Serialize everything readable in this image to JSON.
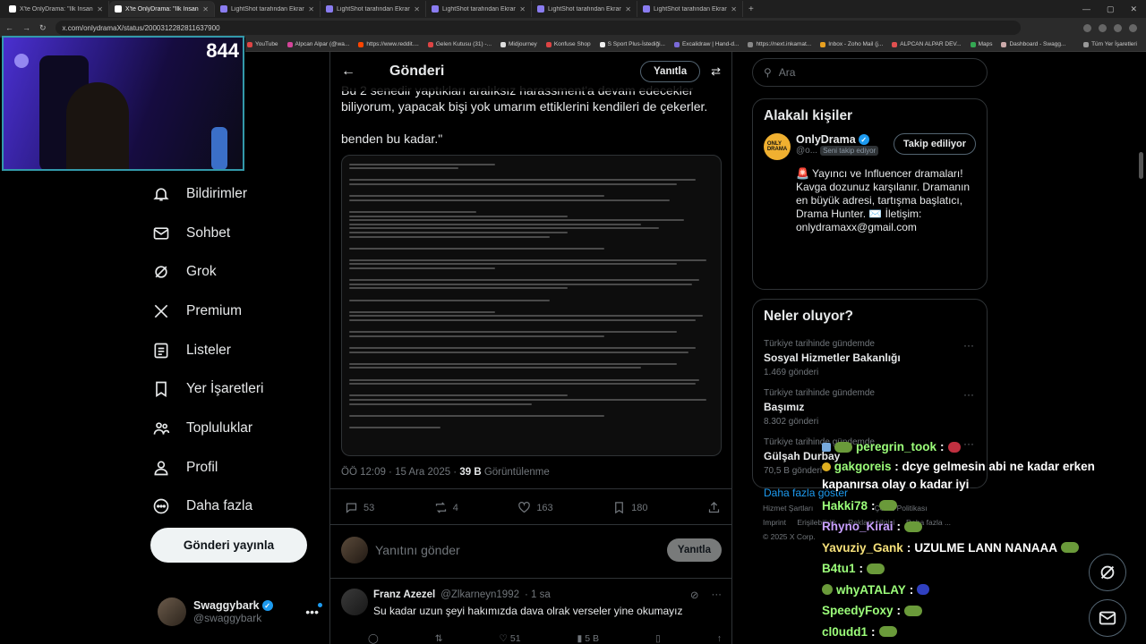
{
  "browser": {
    "tabs": [
      {
        "label": "X'te OnlyDrama: \"İlk İnsan-Jahe",
        "icon": "x",
        "active": false
      },
      {
        "label": "X'te OnlyDrama: \"İlk İnsan-Jahe",
        "icon": "x",
        "active": true
      },
      {
        "label": "LightShot tarafından Ekran Görü",
        "icon": "lightshot",
        "active": false
      },
      {
        "label": "LightShot tarafından Ekran Görü",
        "icon": "lightshot",
        "active": false
      },
      {
        "label": "LightShot tarafından Ekran Görü",
        "icon": "lightshot",
        "active": false
      },
      {
        "label": "LightShot tarafından Ekran Görü",
        "icon": "lightshot",
        "active": false
      },
      {
        "label": "LightShot tarafından Ekran Görü",
        "icon": "lightshot",
        "active": false
      }
    ],
    "url": "x.com/onlydramaX/status/2000312282811637900",
    "bookmarks": [
      "YouTube",
      "Alpcan Alpar (@wa...",
      "https://www.reddit....",
      "Gelen Kutusu (31) -...",
      "Midjourney",
      "Konfuse Shop",
      "S Sport Plus-İstediği...",
      "Excalidraw | Hand-d...",
      "https://next.inkamat...",
      "Inbox - Zoho Mail (j...",
      "ALPCAN ALPAR DEV...",
      "Maps",
      "Dashboard - Swagg..."
    ],
    "bookmarks_all": "Tüm Yer İşaretleri"
  },
  "stream": {
    "viewer_count": "844"
  },
  "nav": {
    "items": [
      {
        "label": "Bildirimler",
        "icon": "bell-icon"
      },
      {
        "label": "Sohbet",
        "icon": "mail-icon"
      },
      {
        "label": "Grok",
        "icon": "grok-icon"
      },
      {
        "label": "Premium",
        "icon": "x-logo-icon"
      },
      {
        "label": "Listeler",
        "icon": "list-icon"
      },
      {
        "label": "Yer İşaretleri",
        "icon": "bookmark-icon"
      },
      {
        "label": "Topluluklar",
        "icon": "people-icon"
      },
      {
        "label": "Profil",
        "icon": "person-icon"
      },
      {
        "label": "Daha fazla",
        "icon": "more-circle-icon"
      }
    ],
    "post_button": "Gönderi yayınla"
  },
  "account": {
    "name": "Swaggybark",
    "handle": "@swaggybark"
  },
  "header": {
    "title": "Gönderi",
    "reply_label": "Yanıtla"
  },
  "post": {
    "text_partial": "Bu 2 senedir yaptıkları aralıksız harassment'a devam edecekler biliyorum, yapacak bişi yok umarım ettiklerini kendileri de çekerler.",
    "text_end": "benden bu kadar.\"",
    "time": "ÖÖ 12:09 · 15 Ara 2025 ·",
    "views_count": "39 B",
    "views_label": "Görüntülenme",
    "stats": {
      "replies": "53",
      "reposts": "4",
      "likes": "163",
      "bookmarks": "180"
    }
  },
  "compose": {
    "placeholder": "Yanıtını gönder",
    "button": "Yanıtla"
  },
  "reply": {
    "name": "Franz Azezel",
    "handle": "@Zlkarneyn1992",
    "time": "· 1 sa",
    "text": "Su kadar uzun şeyi hakımızda dava olrak verseler yine okumayız",
    "stats": {
      "likes": "51",
      "views": "5 B"
    }
  },
  "right": {
    "search_placeholder": "Ara",
    "related_title": "Alakalı kişiler",
    "person": {
      "name": "OnlyDrama",
      "handle": "@o...",
      "follows_you": "Seni takip ediyor",
      "follow_button": "Takip ediliyor",
      "bio": "🚨 Yayıncı ve Influencer dramaları! Kavga dozunuz karşılanır. Dramanın en büyük adresi, tartışma başlatıcı, Drama Hunter. ✉️ İletişim: onlydramaxx@gmail.com"
    },
    "trends_title": "Neler oluyor?",
    "trends": [
      {
        "meta": "Türkiye tarihinde gündemde",
        "name": "Sosyal Hizmetler Bakanlığı",
        "count": "1.469 gönderi"
      },
      {
        "meta": "Türkiye tarihinde gündemde",
        "name": "Başımız",
        "count": "8.302 gönderi"
      },
      {
        "meta": "Türkiye tarihinde gündemde",
        "name": "Gülşah Durbay",
        "count": "70,5 B gönderi"
      }
    ],
    "show_more": "Daha fazla göster",
    "footer": [
      "Hizmet Şartları",
      "Çerez Politikası",
      "Imprint",
      "Erişilebilirlik",
      "Reklam bilgisi",
      "Daha fazla ...",
      "© 2025 X Corp."
    ]
  },
  "chat": [
    {
      "user": "peregrin_took",
      "msg": "",
      "color": "green"
    },
    {
      "user": "gakgoreis",
      "msg": "dcye gelmesin abi ne kadar erken kapanırsa olay o kadar iyi",
      "color": "green"
    },
    {
      "user": "Hakki78",
      "msg": "",
      "color": "green"
    },
    {
      "user": "Rhyno_Kirai",
      "msg": "",
      "color": "purple"
    },
    {
      "user": "Yavuziy_Gank",
      "msg": "UZULME LANN NANAAA",
      "color": "yellow"
    },
    {
      "user": "B4tu1",
      "msg": "",
      "color": "green"
    },
    {
      "user": "whyATALAY",
      "msg": "",
      "color": "green"
    },
    {
      "user": "SpeedyFoxy",
      "msg": "",
      "color": "green"
    },
    {
      "user": "cl0udd1",
      "msg": "",
      "color": "green"
    }
  ]
}
